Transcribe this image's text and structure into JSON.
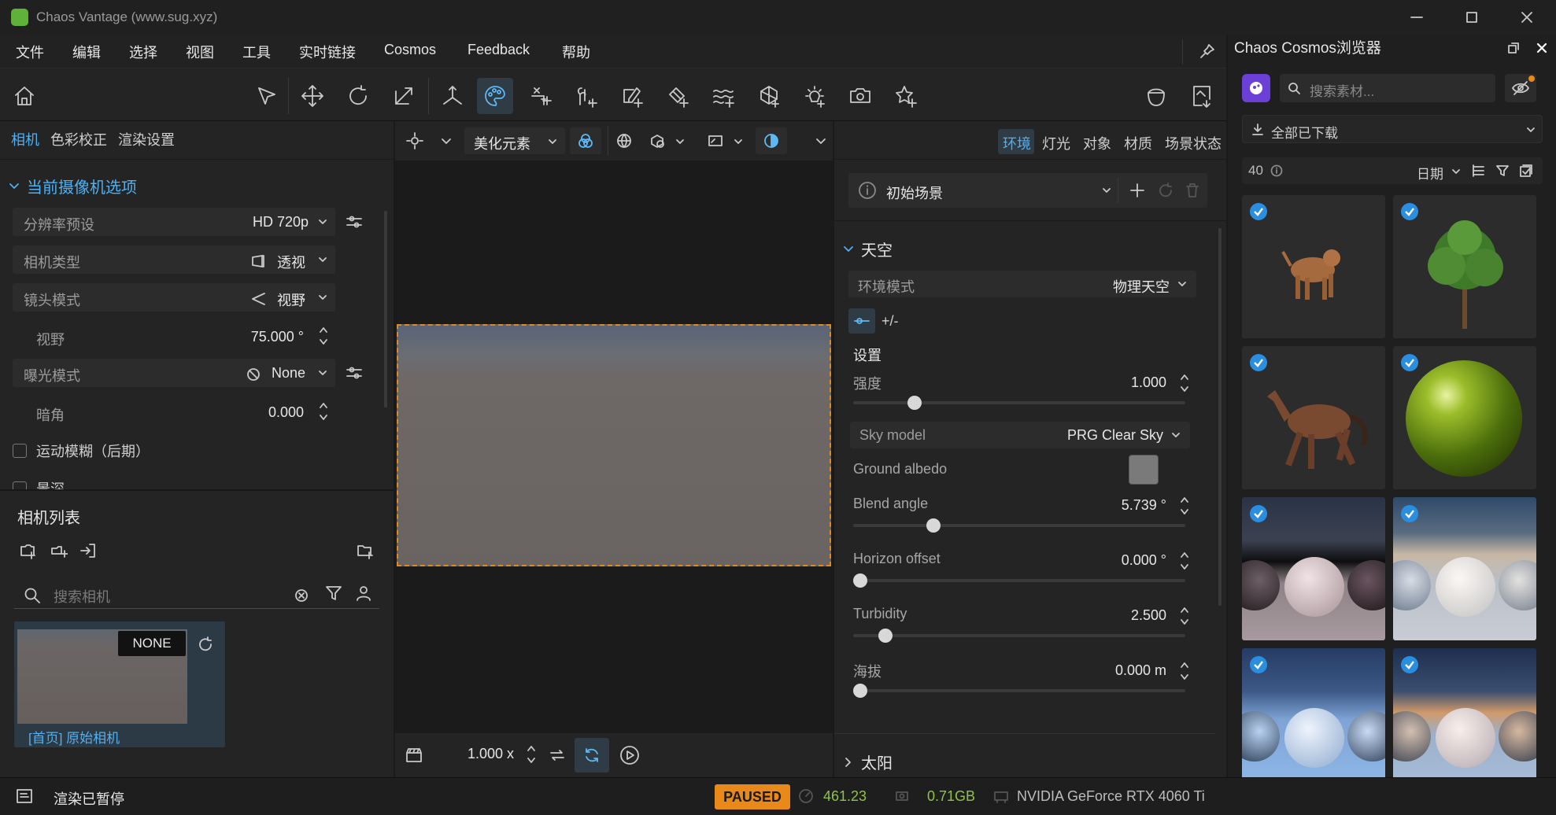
{
  "window": {
    "title": "Chaos Vantage   (www.sug.xyz)"
  },
  "menu": [
    "文件",
    "编辑",
    "选择",
    "视图",
    "工具",
    "实时链接",
    "Cosmos",
    "Feedback",
    "帮助"
  ],
  "left_panel": {
    "tabs": [
      "相机",
      "色彩校正",
      "渲染设置"
    ],
    "section_title": "当前摄像机选项",
    "resolution": {
      "label": "分辨率预设",
      "value": "HD 720p"
    },
    "camera_type": {
      "label": "相机类型",
      "value": "透视"
    },
    "lens_mode": {
      "label": "镜头模式",
      "value": "视野"
    },
    "fov": {
      "label": "视野",
      "value": "75.000 °"
    },
    "exposure": {
      "label": "曝光模式",
      "value": "None"
    },
    "vignette": {
      "label": "暗角",
      "value": "0.000"
    },
    "motion_blur": {
      "label": "运动模糊（后期）"
    },
    "dof": {
      "label": "景深"
    },
    "camera_list_title": "相机列表",
    "search_placeholder": "搜索相机",
    "camera_card": {
      "badge": "NONE",
      "name": "[首页] 原始相机"
    }
  },
  "viewport": {
    "dropdown": "美化元素",
    "speed": "1.000 x"
  },
  "env_panel": {
    "tabs": [
      "环境",
      "灯光",
      "对象",
      "材质",
      "场景状态"
    ],
    "scene": "初始场景",
    "sky_title": "天空",
    "env_mode": {
      "label": "环境模式",
      "value": "物理天空"
    },
    "plusminus": "+/-",
    "settings_title": "设置",
    "intensity": {
      "label": "强度",
      "value": "1.000",
      "level": 0.17
    },
    "sky_model": {
      "label": "Sky model",
      "value": "PRG Clear Sky"
    },
    "ground_albedo": {
      "label": "Ground albedo"
    },
    "blend_angle": {
      "label": "Blend angle",
      "value": "5.739 °",
      "level": 0.23
    },
    "horizon_offset": {
      "label": "Horizon offset",
      "value": "0.000 °",
      "level": 0.0
    },
    "turbidity": {
      "label": "Turbidity",
      "value": "2.500",
      "level": 0.08
    },
    "altitude": {
      "label": "海拔",
      "value": "0.000 m",
      "level": 0.0
    },
    "sun_title": "太阳"
  },
  "cosmos": {
    "title": "Chaos Cosmos浏览器",
    "search_placeholder": "搜索素材...",
    "filter": "全部已下载",
    "count": "40",
    "sort": "日期"
  },
  "status": {
    "text": "渲染已暂停",
    "badge": "PAUSED",
    "fps": "461.23",
    "memory": "0.71GB",
    "gpu": "NVIDIA GeForce RTX 4060 Ti"
  },
  "colors": {
    "accent": "#4fb0f2",
    "paused": "#e8891a",
    "green": "#8fc24a"
  }
}
